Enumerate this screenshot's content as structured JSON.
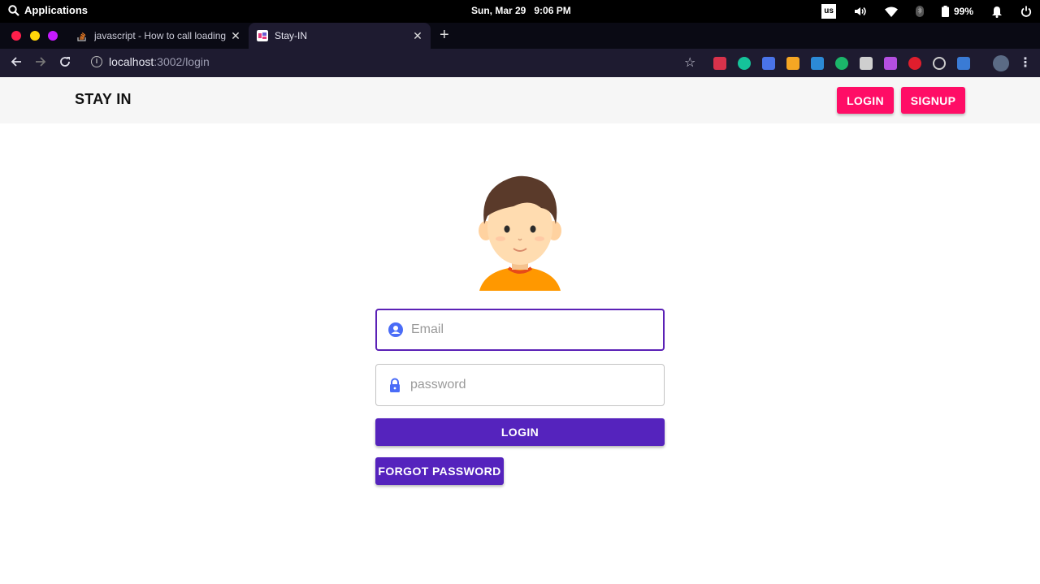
{
  "os": {
    "apps_label": "Applications",
    "date": "Sun, Mar 29",
    "time": "9:06 PM",
    "keyboard_layout": "us",
    "battery": "99%"
  },
  "browser": {
    "tabs": [
      {
        "title": "javascript - How to call loading",
        "favicon": "stackoverflow-icon",
        "active": false
      },
      {
        "title": "Stay-IN",
        "favicon": "stay-in-favicon",
        "active": true
      }
    ],
    "url_host": "localhost",
    "url_path": ":3002/login"
  },
  "header": {
    "brand": "STAY IN",
    "login_label": "LOGIN",
    "signup_label": "SIGNUP"
  },
  "form": {
    "email_placeholder": "Email",
    "password_placeholder": "password",
    "login_label": "LOGIN",
    "forgot_label": "FORGOT PASSWORD"
  },
  "colors": {
    "accent_pink": "#ff0d66",
    "primary_purple": "#5523bd",
    "icon_blue": "#4a6cf7"
  }
}
